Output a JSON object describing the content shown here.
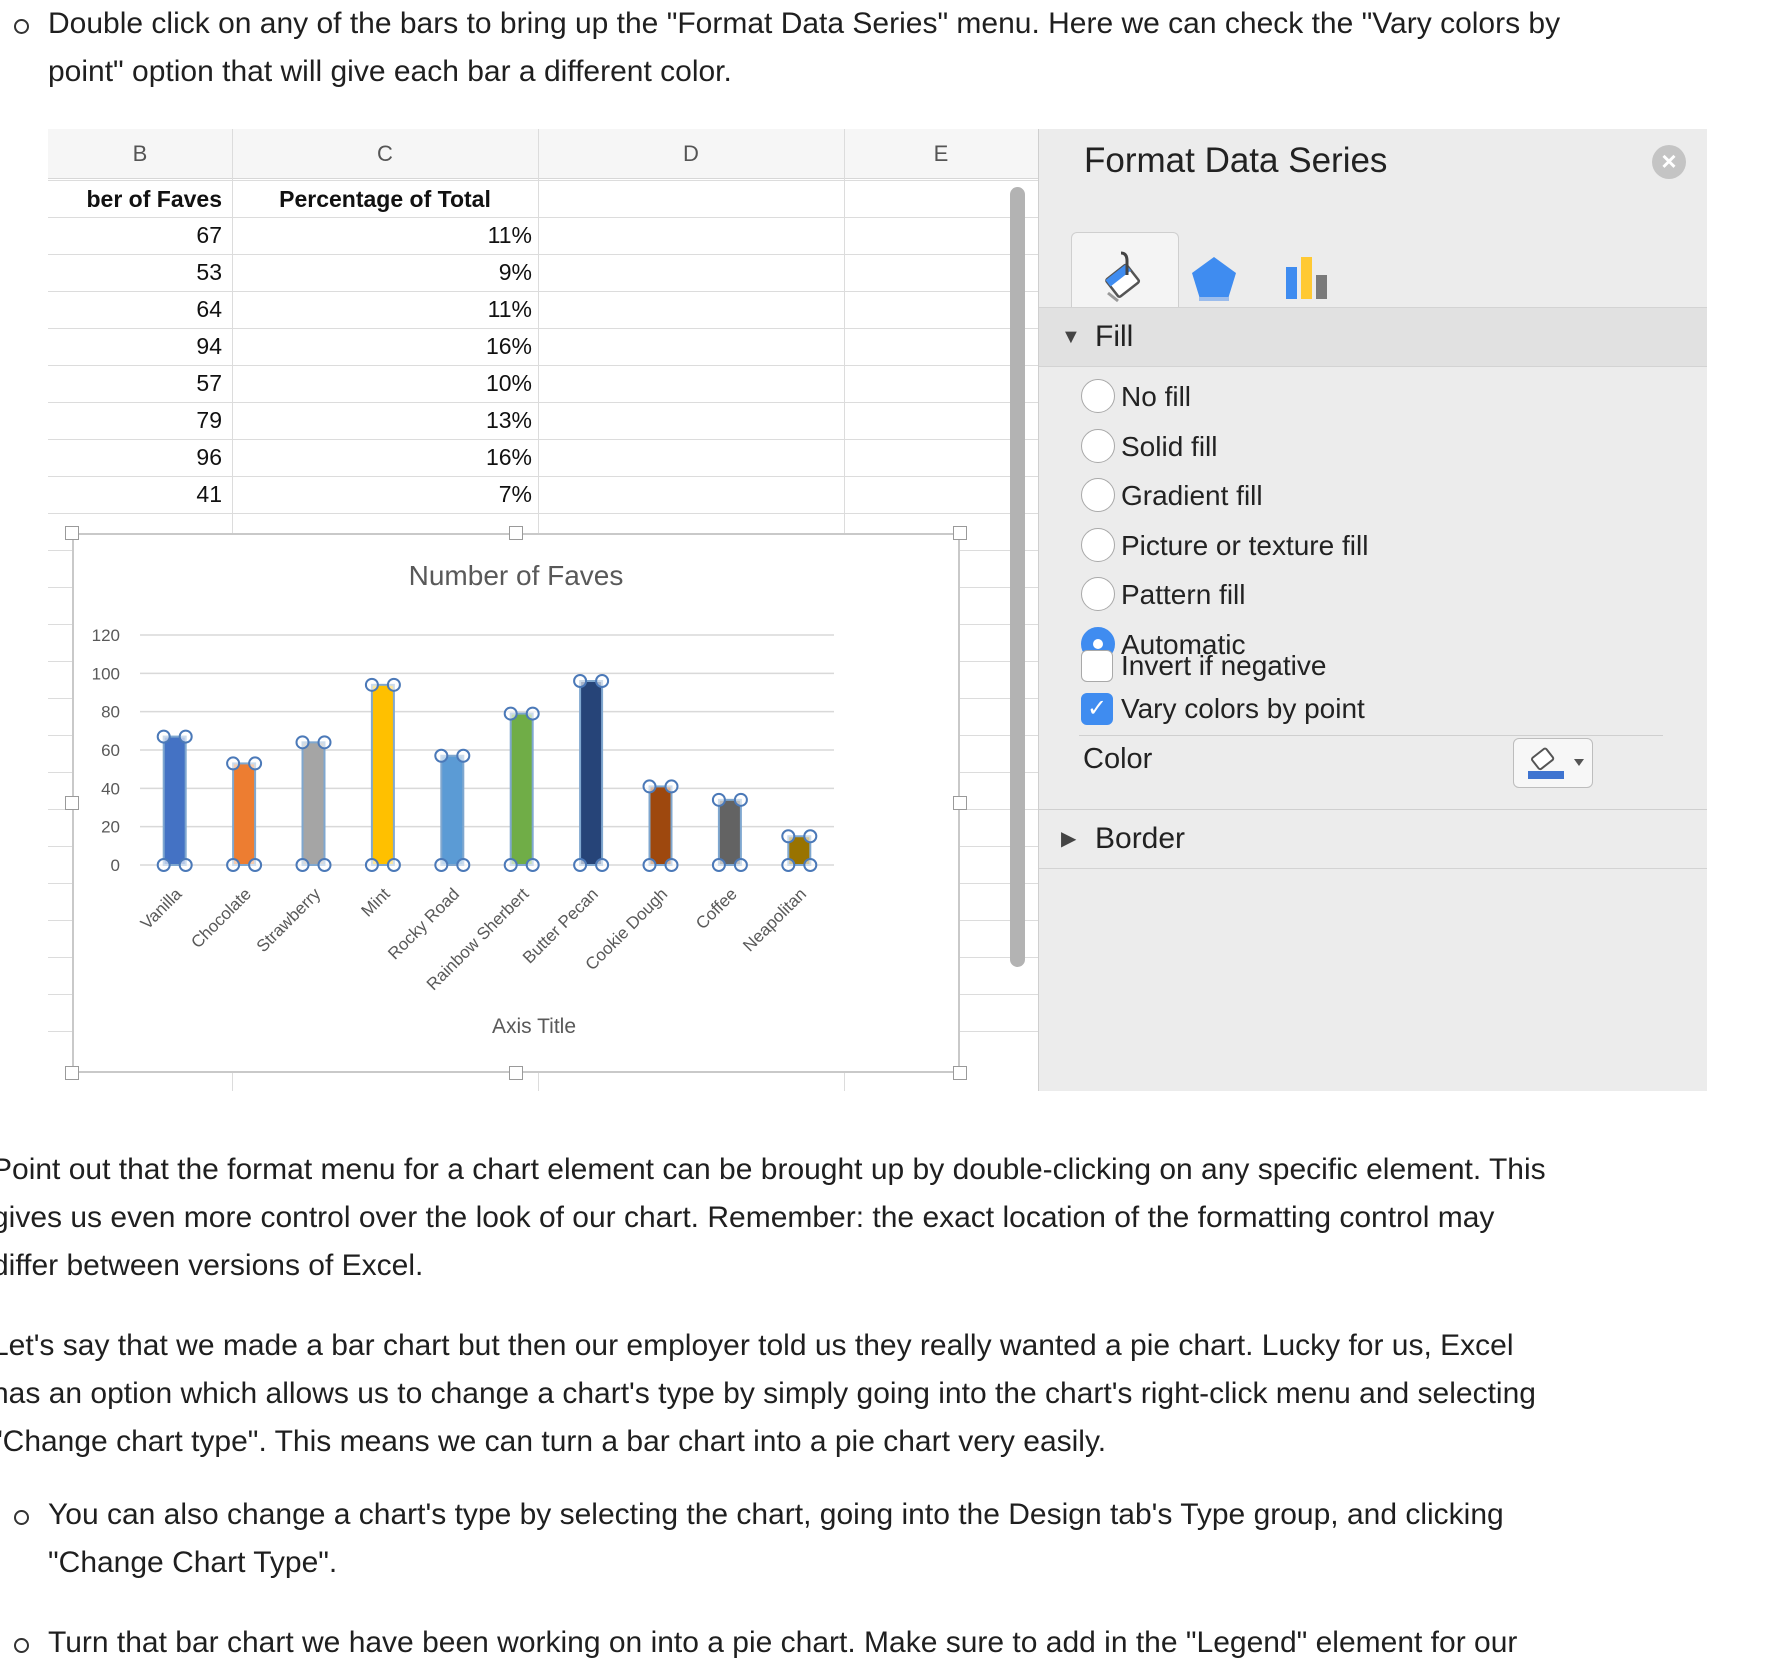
{
  "doc": {
    "bullet1": [
      "Double click on any of the bars to bring up the \"Format Data Series\" menu. Here we can check the \"Vary colors by",
      "point\" option that will give each bar a different color."
    ],
    "para1": [
      "Point out that the format menu for a chart element can be brought up by double-clicking on any specific element. This",
      "gives us even more control over the look of our chart. Remember: the exact location of the formatting control may",
      "differ between versions of Excel."
    ],
    "para2": [
      "Let's say that we made a bar chart but then our employer told us they really wanted a pie chart. Lucky for us, Excel",
      "has an option which allows us to change a chart's type by simply going into the chart's right-click menu and selecting",
      "\"Change chart type\". This means we can turn a bar chart into a pie chart very easily."
    ],
    "bullet2": [
      "You can also change a chart's type by selecting the chart, going into the Design tab's Type group, and clicking",
      "\"Change Chart Type\"."
    ],
    "bullet3": [
      "Turn that bar chart we have been working on into a pie chart. Make sure to add in the \"Legend\" element for our"
    ]
  },
  "sheet": {
    "columns": [
      "B",
      "C",
      "D",
      "E"
    ],
    "header_b": "ber of Faves",
    "header_c": "Percentage of Total",
    "rows": [
      {
        "faves": "67",
        "pct": "11%"
      },
      {
        "faves": "53",
        "pct": "9%"
      },
      {
        "faves": "64",
        "pct": "11%"
      },
      {
        "faves": "94",
        "pct": "16%"
      },
      {
        "faves": "57",
        "pct": "10%"
      },
      {
        "faves": "79",
        "pct": "13%"
      },
      {
        "faves": "96",
        "pct": "16%"
      },
      {
        "faves": "41",
        "pct": "7%"
      }
    ]
  },
  "panel": {
    "title": "Format Data Series",
    "close": "×",
    "tabs": [
      "paint-bucket-icon",
      "pentagon-icon",
      "bar-chart-icon"
    ],
    "fill_section": "Fill",
    "fill_options": [
      "No fill",
      "Solid fill",
      "Gradient fill",
      "Picture or texture fill",
      "Pattern fill",
      "Automatic"
    ],
    "fill_selected": "Automatic",
    "invert_label": "Invert if negative",
    "invert_checked": false,
    "vary_label": "Vary colors by point",
    "vary_checked": true,
    "check_glyph": "✓",
    "color_label": "Color",
    "border_section": "Border",
    "accent": "#3f8cf0"
  },
  "chart_data": {
    "type": "bar",
    "title": "Number of Faves",
    "xlabel": "Axis Title",
    "ylabel": "",
    "ylim": [
      0,
      120
    ],
    "yticks": [
      0,
      20,
      40,
      60,
      80,
      100,
      120
    ],
    "categories": [
      "Vanilla",
      "Chocolate",
      "Strawberry",
      "Mint",
      "Rocky Road",
      "Rainbow Sherbert",
      "Butter Pecan",
      "Cookie Dough",
      "Coffee",
      "Neapolitan"
    ],
    "values": [
      67,
      53,
      64,
      94,
      57,
      79,
      96,
      41,
      34,
      15
    ],
    "colors": [
      "#4472c4",
      "#ed7d31",
      "#a5a5a5",
      "#ffc000",
      "#5b9bd5",
      "#70ad47",
      "#264478",
      "#9e480e",
      "#636363",
      "#997300"
    ],
    "grid": true,
    "legend": "none"
  }
}
